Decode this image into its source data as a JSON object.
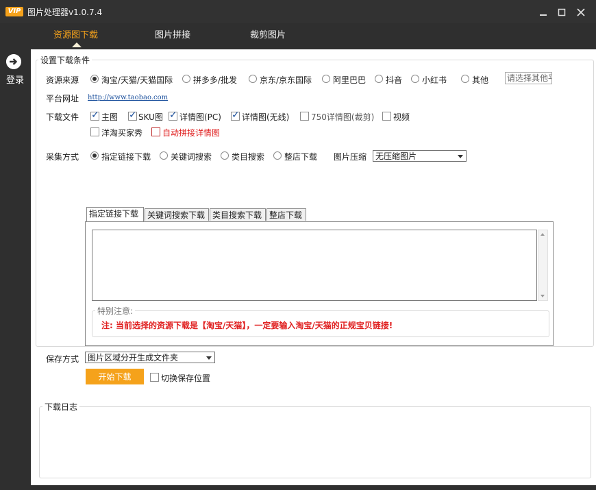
{
  "app": {
    "logo": "VIP",
    "title": "图片处理器v1.0.7.4"
  },
  "nav": {
    "tabs": [
      "资源图下载",
      "图片拼接",
      "裁剪图片"
    ]
  },
  "sidebar": {
    "login_label": "登录"
  },
  "conditions": {
    "legend": "设置下载条件",
    "source_label": "资源来源",
    "sources": [
      "淘宝/天猫/天猫国际",
      "拼多多/批发",
      "京东/京东国际",
      "阿里巴巴",
      "抖音",
      "小红书",
      "其他"
    ],
    "other_placeholder": "请选择其他平",
    "platform_url_label": "平台网址",
    "platform_url": "http://www.taobao.com",
    "files_label": "下载文件",
    "files": [
      {
        "label": "主图",
        "checked": true
      },
      {
        "label": "SKU图",
        "checked": true
      },
      {
        "label": "详情图(PC)",
        "checked": true
      },
      {
        "label": "详情图(无线)",
        "checked": true
      },
      {
        "label": "750详情图(裁剪)",
        "checked": false
      },
      {
        "label": "视频",
        "checked": false
      },
      {
        "label": "洋淘买家秀",
        "checked": false
      },
      {
        "label": "自动拼接详情图",
        "checked": false
      }
    ],
    "collect_label": "采集方式",
    "collect_modes": [
      "指定链接下载",
      "关键词搜索",
      "类目搜索",
      "整店下载"
    ],
    "compress_label": "图片压缩",
    "compress_value": "无压缩图片"
  },
  "tabs": [
    "指定链接下载",
    "关键词搜索下载",
    "类目搜索下载",
    "整店下载"
  ],
  "notice": {
    "legend": "特别注意:",
    "text": "注: 当前选择的资源下载是【淘宝/天猫】，一定要输入淘宝/天猫的正规宝贝链接!"
  },
  "save": {
    "label": "保存方式",
    "value": "图片区域分开生成文件夹",
    "start_button": "开始下载",
    "toggle_label": "切换保存位置"
  },
  "log": {
    "legend": "下载日志"
  },
  "colors": {
    "accent": "#f5a21b",
    "titlebar": "#323232",
    "warning": "#e02020",
    "link": "#1a4f9c"
  }
}
